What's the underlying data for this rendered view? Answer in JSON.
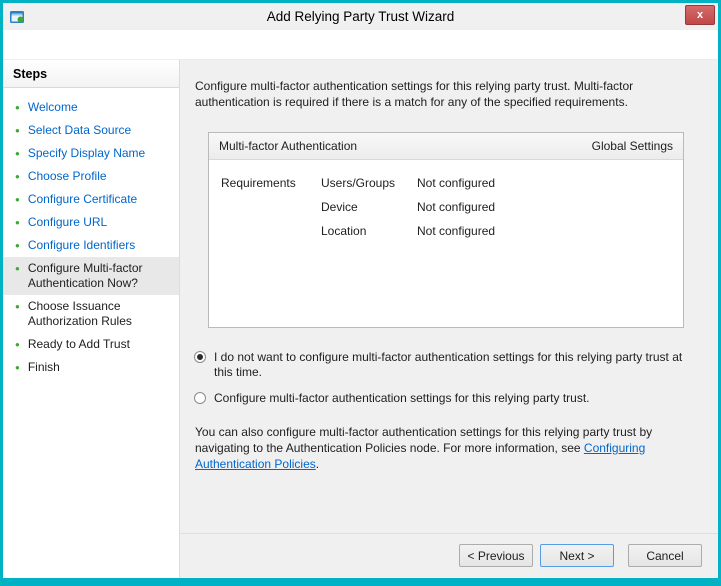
{
  "window": {
    "title": "Add Relying Party Trust Wizard"
  },
  "icons": {
    "close": "x",
    "step_bullet": "●"
  },
  "colors": {
    "accent_teal": "#00b2c3",
    "link_blue": "#0066cc",
    "bullet_green": "#3aaa35",
    "close_red": "#c75050"
  },
  "sidebar": {
    "header": "Steps",
    "items": [
      {
        "label": "Welcome",
        "state": "done"
      },
      {
        "label": "Select Data Source",
        "state": "done"
      },
      {
        "label": "Specify Display Name",
        "state": "done"
      },
      {
        "label": "Choose Profile",
        "state": "done"
      },
      {
        "label": "Configure Certificate",
        "state": "done"
      },
      {
        "label": "Configure URL",
        "state": "done"
      },
      {
        "label": "Configure Identifiers",
        "state": "done"
      },
      {
        "label": "Configure Multi-factor Authentication Now?",
        "state": "current"
      },
      {
        "label": "Choose Issuance Authorization Rules",
        "state": "upcoming"
      },
      {
        "label": "Ready to Add Trust",
        "state": "upcoming"
      },
      {
        "label": "Finish",
        "state": "upcoming"
      }
    ]
  },
  "main": {
    "intro": "Configure multi-factor authentication settings for this relying party trust. Multi-factor authentication is required if there is a match for any of the specified requirements.",
    "table": {
      "header_left": "Multi-factor Authentication",
      "header_right": "Global Settings",
      "row_label": "Requirements",
      "rows": [
        {
          "name": "Users/Groups",
          "value": "Not configured"
        },
        {
          "name": "Device",
          "value": "Not configured"
        },
        {
          "name": "Location",
          "value": "Not configured"
        }
      ]
    },
    "radios": [
      {
        "label": "I do not want to configure multi-factor authentication settings for this relying party trust at this time.",
        "checked": true
      },
      {
        "label": "Configure multi-factor authentication settings for this relying party trust.",
        "checked": false
      }
    ],
    "footnote_before": "You can also configure multi-factor authentication settings for this relying party trust by navigating to the Authentication Policies node. For more information, see ",
    "footnote_link": "Configuring Authentication Policies",
    "footnote_after": "."
  },
  "buttons": {
    "previous": "< Previous",
    "next": "Next >",
    "cancel": "Cancel"
  }
}
